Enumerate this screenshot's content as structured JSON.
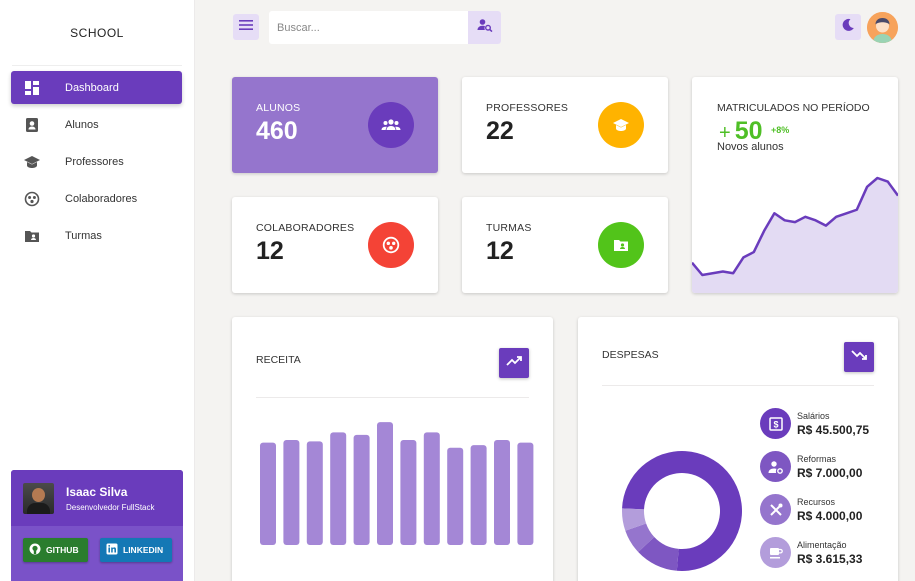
{
  "app": {
    "brand": "SCHOOL"
  },
  "sidebar": {
    "items": [
      {
        "label": "Dashboard",
        "icon": "dashboard-icon",
        "active": true
      },
      {
        "label": "Alunos",
        "icon": "student-card-icon",
        "active": false
      },
      {
        "label": "Professores",
        "icon": "graduation-cap-icon",
        "active": false
      },
      {
        "label": "Colaboradores",
        "icon": "group-icon",
        "active": false
      },
      {
        "label": "Turmas",
        "icon": "folder-user-icon",
        "active": false
      }
    ],
    "profile": {
      "name": "Isaac Silva",
      "role": "Desenvolvedor FullStack",
      "github": "GITHUB",
      "linkedin": "LINKEDIN"
    }
  },
  "topbar": {
    "search_placeholder": "Buscar..."
  },
  "stats": [
    {
      "title": "ALUNOS",
      "value": "460",
      "icon": "users-icon",
      "color": "#6a3cbc"
    },
    {
      "title": "PROFESSORES",
      "value": "22",
      "icon": "graduation-cap-icon",
      "color": "#ffb300"
    },
    {
      "title": "COLABORADORES",
      "value": "12",
      "icon": "group-icon",
      "color": "#f44336"
    },
    {
      "title": "TURMAS",
      "value": "12",
      "icon": "folder-user-icon",
      "color": "#52c41a"
    }
  ],
  "enrolled": {
    "title": "MATRICULADOS NO PERÍODO",
    "plus": "+",
    "value": "50",
    "delta": "+8%",
    "subtitle": "Novos alunos",
    "series": [
      12,
      5,
      6,
      7,
      6,
      15,
      18,
      30,
      40,
      36,
      35,
      38,
      36,
      33,
      38,
      40,
      42,
      55,
      60,
      58,
      50
    ]
  },
  "receita": {
    "title": "RECEITA",
    "icon": "trending-up-icon",
    "chart_data": {
      "type": "bar",
      "values": [
        80,
        82,
        81,
        88,
        86,
        96,
        82,
        88,
        76,
        78,
        82,
        80
      ],
      "ylim": [
        0,
        100
      ]
    }
  },
  "despesas": {
    "title": "DESPESAS",
    "icon": "trending-down-icon",
    "chart_data": {
      "type": "pie",
      "categories": [
        "Salários",
        "Reformas",
        "Recursos",
        "Alimentação"
      ],
      "values": [
        45500.75,
        7000.0,
        4000.0,
        3615.33
      ]
    },
    "legend": [
      {
        "name": "Salários",
        "value": "R$ 45.500,75",
        "icon": "money-icon",
        "color": "#6a3cbc"
      },
      {
        "name": "Reformas",
        "value": "R$ 7.000,00",
        "icon": "user-settings-icon",
        "color": "#7e57c2"
      },
      {
        "name": "Recursos",
        "value": "R$ 4.000,00",
        "icon": "tools-icon",
        "color": "#9575cd"
      },
      {
        "name": "Alimentação",
        "value": "R$ 3.615,33",
        "icon": "coffee-icon",
        "color": "#b39ddb"
      }
    ]
  }
}
